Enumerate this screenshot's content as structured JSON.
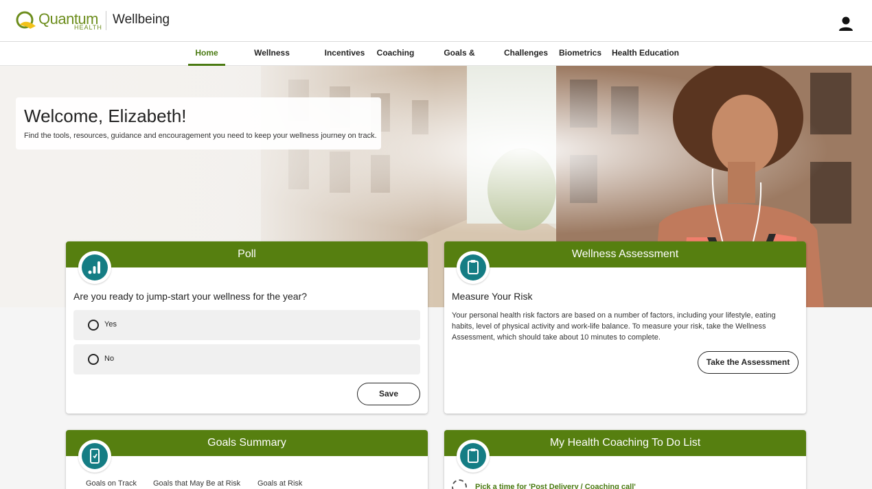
{
  "brand": {
    "logo_text": "Quantum",
    "logo_sub": "HEALTH",
    "app_title": "Wellbeing",
    "accent_color": "#567f10",
    "teal_color": "#157d84"
  },
  "header": {
    "user_icon": "user-icon"
  },
  "nav": {
    "items": [
      {
        "label": "Home",
        "active": true
      },
      {
        "label": "Wellness Assessment",
        "active": false
      },
      {
        "label": "Incentives",
        "active": false
      },
      {
        "label": "Coaching",
        "active": false
      },
      {
        "label": "Goals & Activities",
        "active": false
      },
      {
        "label": "Challenges",
        "active": false
      },
      {
        "label": "Biometrics",
        "active": false
      },
      {
        "label": "Health Education",
        "active": false
      }
    ]
  },
  "hero": {
    "welcome_title": "Welcome, Elizabeth!",
    "welcome_sub": "Find the tools, resources, guidance and encouragement you need to keep your wellness journey on track."
  },
  "poll": {
    "header": "Poll",
    "icon": "bar-chart-icon",
    "question": "Are you ready to jump-start your wellness for the year?",
    "options": [
      "Yes",
      "No"
    ],
    "save_label": "Save"
  },
  "wellness": {
    "header": "Wellness Assessment",
    "icon": "clipboard-icon",
    "title": "Measure Your Risk",
    "body": "Your personal health risk factors are based on a number of factors, including your lifestyle, eating habits, level of physical activity and work-life balance. To measure your risk, take the Wellness Assessment, which should take about 10 minutes to complete.",
    "button_label": "Take the Assessment"
  },
  "goals": {
    "header": "Goals Summary",
    "icon": "phone-list-icon",
    "columns": [
      "Goals on Track",
      "Goals that May Be at Risk",
      "Goals at Risk"
    ]
  },
  "coaching": {
    "header": "My Health Coaching To Do List",
    "icon": "clipboard-icon",
    "todo_link": "Pick a time for 'Post Delivery / Coaching call'"
  }
}
